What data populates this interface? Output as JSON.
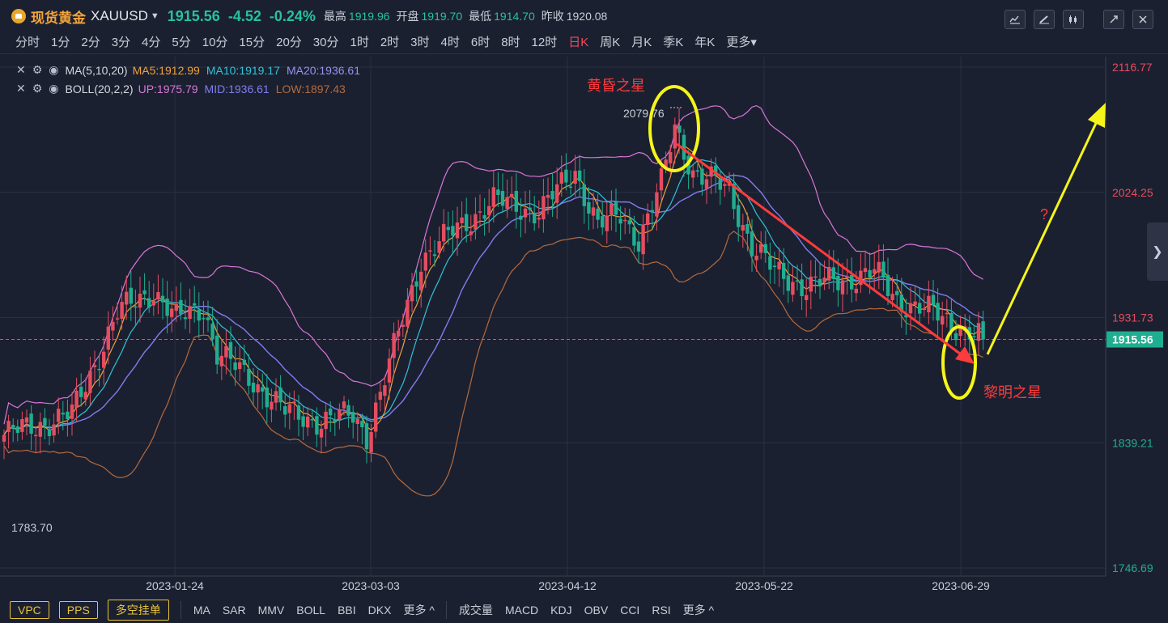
{
  "header": {
    "name": "现货黄金",
    "symbol": "XAUUSD",
    "price": "1915.56",
    "change": "-4.52",
    "change_pct": "-0.24%",
    "high_label": "最高",
    "high": "1919.96",
    "open_label": "开盘",
    "open": "1919.70",
    "low_label": "最低",
    "low": "1914.70",
    "prev_label": "昨收",
    "prev": "1920.08"
  },
  "timeframes": [
    "分时",
    "1分",
    "2分",
    "3分",
    "4分",
    "5分",
    "10分",
    "15分",
    "20分",
    "30分",
    "1时",
    "2时",
    "3时",
    "4时",
    "6时",
    "8时",
    "12时",
    "日K",
    "周K",
    "月K",
    "季K",
    "年K",
    "更多"
  ],
  "active_timeframe": "日K",
  "indicators": {
    "ma": {
      "name": "MA(5,10,20)",
      "ma5": "MA5:1912.99",
      "ma10": "MA10:1919.17",
      "ma20": "MA20:1936.61"
    },
    "boll": {
      "name": "BOLL(20,2,2)",
      "up": "UP:1975.79",
      "mid": "MID:1936.61",
      "low": "LOW:1897.43"
    }
  },
  "bottom": {
    "boxes": [
      "VPC",
      "PPS",
      "多空挂单"
    ],
    "main_ind": [
      "MA",
      "SAR",
      "MMV",
      "BOLL",
      "BBI",
      "DKX",
      "更多"
    ],
    "sub_ind": [
      "成交量",
      "MACD",
      "KDJ",
      "OBV",
      "CCI",
      "RSI",
      "更多"
    ]
  },
  "colors": {
    "up": "#e54d5f",
    "down": "#1fae8f",
    "ma5": "#f0a23a",
    "ma10": "#2fc4d6",
    "ma20": "#7f7ef0",
    "boll_up": "#d877d8",
    "boll_low": "#b56a3c",
    "annot": "#ff3b3b",
    "highlight": "#f5f51a"
  },
  "chart_data": {
    "type": "candlestick",
    "y_ticks": [
      "2116.77",
      "2024.25",
      "1931.73",
      "1839.21",
      "1746.69"
    ],
    "x_ticks": [
      "2023-01-24",
      "2023-03-03",
      "2023-04-12",
      "2023-05-22",
      "2023-06-29"
    ],
    "ylim": [
      1746.69,
      2116.77
    ],
    "current_price": "1915.56",
    "max_label": "2079.76",
    "min_label": "1783.70",
    "annotations": {
      "evening_star": "黄昏之星",
      "morning_star": "黎明之星",
      "question": "?"
    }
  }
}
